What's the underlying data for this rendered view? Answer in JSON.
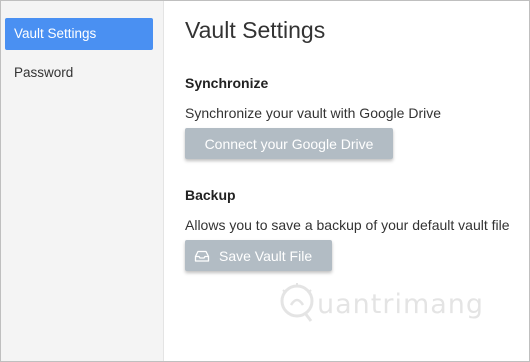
{
  "sidebar": {
    "items": [
      {
        "label": "Vault Settings",
        "active": true
      },
      {
        "label": "Password",
        "active": false
      }
    ]
  },
  "main": {
    "title": "Vault Settings",
    "synchronize": {
      "heading": "Synchronize",
      "description": "Synchronize your vault with Google Drive",
      "button_label": "Connect your Google Drive"
    },
    "backup": {
      "heading": "Backup",
      "description": "Allows you to save a backup of your default vault file",
      "button_label": "Save Vault File",
      "button_icon": "inbox-tray-icon"
    }
  },
  "watermark": {
    "text": "uantrimang",
    "icon": "bulb-logo"
  },
  "colors": {
    "accent": "#4a90f2",
    "button_bg": "#b2bcc4",
    "sidebar_bg": "#f4f4f4"
  }
}
